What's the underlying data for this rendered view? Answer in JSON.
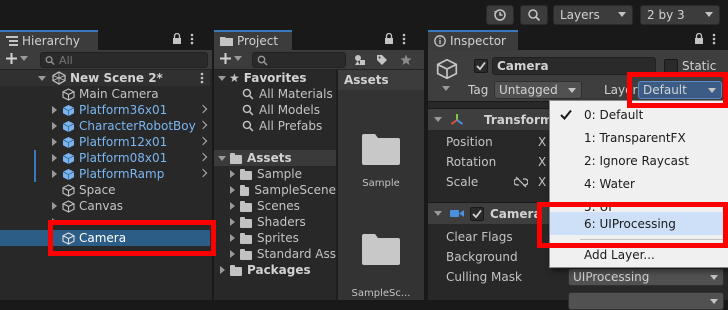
{
  "toolbar": {
    "history_icon": "history-icon",
    "search_icon": "search-icon",
    "layers_label": "Layers",
    "layout_label": "2 by 3"
  },
  "hierarchy": {
    "tab_label": "Hierarchy",
    "search_placeholder": "All",
    "scene": "New Scene 2*",
    "items": [
      {
        "label": "Main Camera",
        "prefab": false
      },
      {
        "label": "Platform36x01",
        "prefab": true
      },
      {
        "label": "CharacterRobotBoy",
        "prefab": true
      },
      {
        "label": "Platform12x01",
        "prefab": true
      },
      {
        "label": "Platform08x01",
        "prefab": true
      },
      {
        "label": "PlatformRamp",
        "prefab": true
      },
      {
        "label": "Space",
        "prefab": false
      },
      {
        "label": "Canvas",
        "prefab": false
      },
      {
        "label": "Camera",
        "prefab": false,
        "selected": true
      }
    ]
  },
  "project": {
    "tab_label": "Project",
    "favorites_label": "Favorites",
    "favorites": [
      "All Materials",
      "All Models",
      "All Prefabs"
    ],
    "assets_label": "Assets",
    "asset_folders": [
      "Sample",
      "SampleScene",
      "Scenes",
      "Shaders",
      "Sprites",
      "Standard Ass"
    ],
    "packages_label": "Packages",
    "grid_header": "Assets",
    "grid_items": [
      "Sample",
      "SampleSc..."
    ]
  },
  "inspector": {
    "tab_label": "Inspector",
    "object_name": "Camera",
    "static_label": "Static",
    "tag_label": "Tag",
    "tag_value": "Untagged",
    "layer_label": "Layer",
    "layer_value": "Default",
    "transform_label": "Transform",
    "position_label": "Position",
    "rotation_label": "Rotation",
    "scale_label": "Scale",
    "axis_x": "X",
    "camera_label": "Camera",
    "clear_flags_label": "Clear Flags",
    "background_label": "Background",
    "culling_mask_label": "Culling Mask",
    "culling_mask_value": "UIProcessing"
  },
  "layer_popup": {
    "items": [
      {
        "label": "0: Default",
        "checked": true
      },
      {
        "label": "1: TransparentFX",
        "checked": false
      },
      {
        "label": "2: Ignore Raycast",
        "checked": false
      },
      {
        "label": "4: Water",
        "checked": false
      },
      {
        "label": "5: UI",
        "checked": false
      },
      {
        "label": "6: UIProcessing",
        "checked": false,
        "highlighted": true
      }
    ],
    "add_layer_label": "Add Layer..."
  },
  "colors": {
    "accent": "#3a79bb",
    "prefab_text": "#7bb5f0",
    "highlight_box": "#ff0000",
    "popup_bg": "#f0f0f0"
  }
}
